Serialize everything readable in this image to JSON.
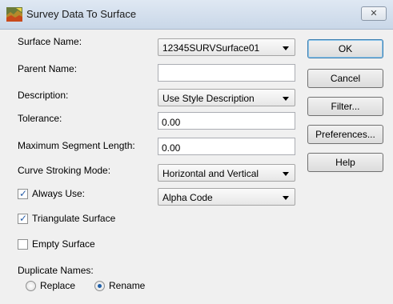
{
  "window": {
    "title": "Survey Data To Surface",
    "close_glyph": "✕"
  },
  "fields": {
    "surface_name": {
      "label": "Surface Name:",
      "value": "12345SURVSurface01"
    },
    "parent_name": {
      "label": "Parent Name:",
      "value": ""
    },
    "description": {
      "label": "Description:",
      "value": "Use Style Description"
    },
    "tolerance": {
      "label": "Tolerance:",
      "value": "0.00"
    },
    "max_segment_length": {
      "label": "Maximum Segment Length:",
      "value": "0.00"
    },
    "curve_stroking_mode": {
      "label": "Curve Stroking Mode:",
      "value": "Horizontal and Vertical"
    },
    "always_use": {
      "label": "Always Use:",
      "checked": true,
      "value": "Alpha Code"
    },
    "triangulate_surface": {
      "label": "Triangulate Surface",
      "checked": true
    },
    "empty_surface": {
      "label": "Empty Surface",
      "checked": false
    }
  },
  "duplicate_names": {
    "label": "Duplicate Names:",
    "options": [
      {
        "label": "Replace",
        "selected": false
      },
      {
        "label": "Rename",
        "selected": true
      }
    ]
  },
  "buttons": {
    "ok": "OK",
    "cancel": "Cancel",
    "filter": "Filter...",
    "preferences": "Preferences...",
    "help": "Help"
  },
  "check_glyph": "✓"
}
